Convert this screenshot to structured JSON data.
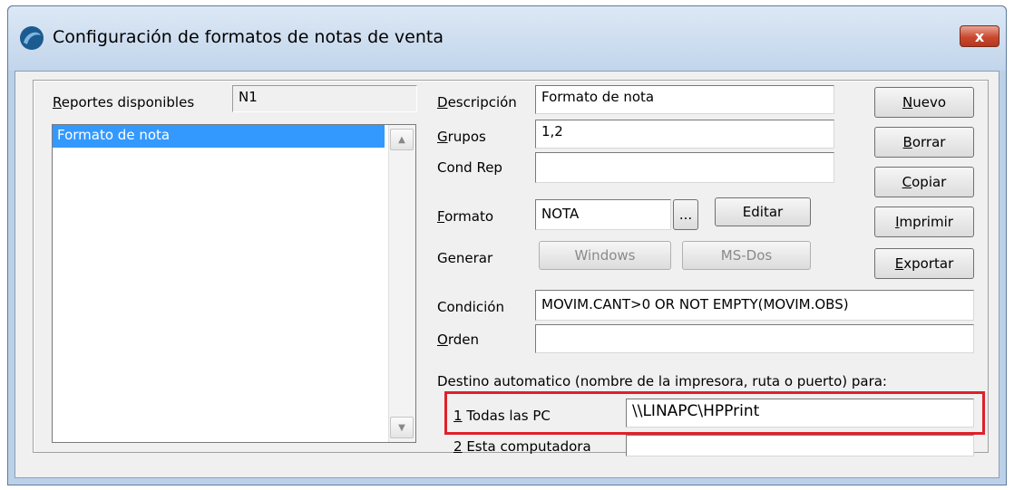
{
  "window": {
    "title": "Configuración de formatos de notas de venta",
    "close_label": "x"
  },
  "left": {
    "reportes_label_u": "R",
    "reportes_label_rest": "eportes disponibles",
    "reportes_code": "N1",
    "list_items": [
      "Formato de nota"
    ]
  },
  "form": {
    "descripcion_label_u": "D",
    "descripcion_label_rest": "escripción",
    "descripcion_value": "Formato de nota",
    "grupos_label_u": "G",
    "grupos_label_rest": "rupos",
    "grupos_value": "1,2",
    "condrep_label": "Cond Rep",
    "condrep_value": "",
    "formato_label_u": "F",
    "formato_label_rest": "ormato",
    "formato_value": "NOTA",
    "browse_label": "...",
    "editar_label": "Editar",
    "generar_label": "Generar",
    "windows_label": "Windows",
    "msdos_label": "MS-Dos",
    "condicion_label": "Condición",
    "condicion_value": "MOVIM.CANT>0 OR NOT EMPTY(MOVIM.OBS)",
    "orden_label_u": "O",
    "orden_label_rest": "rden",
    "orden_value": "",
    "destino_label": "Destino automatico (nombre de la impresora, ruta o puerto) para:",
    "todas_label_u": "1",
    "todas_label_rest": " Todas las PC",
    "todas_value": "\\\\LINAPC\\HPPrint",
    "esta_label_u": "2",
    "esta_label_rest": " Esta computadora",
    "esta_value": ""
  },
  "buttons": {
    "nuevo_u": "N",
    "nuevo_rest": "uevo",
    "borrar_u": "B",
    "borrar_rest": "orrar",
    "copiar_u": "C",
    "copiar_rest": "opiar",
    "imprimir_u": "I",
    "imprimir_rest": "mprimir",
    "exportar_u": "E",
    "exportar_rest": "xportar"
  },
  "colors": {
    "selection": "#3399ff",
    "highlight_box": "#e0202a"
  }
}
